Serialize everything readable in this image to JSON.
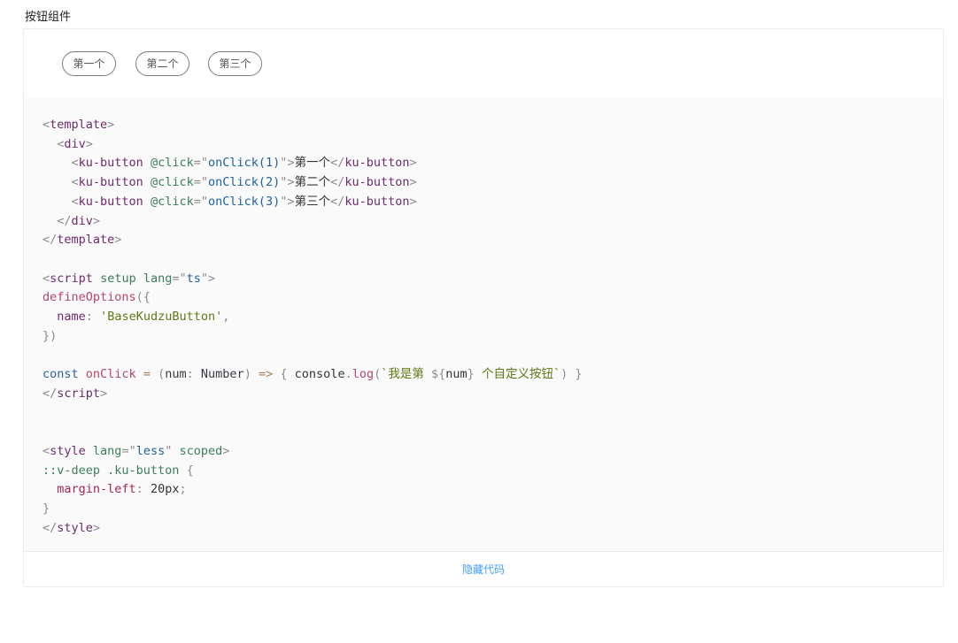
{
  "page": {
    "title": "按钮组件"
  },
  "preview": {
    "buttons": [
      {
        "label": "第一个"
      },
      {
        "label": "第二个"
      },
      {
        "label": "第三个"
      }
    ]
  },
  "code": {
    "lines": {
      "l1_tag": "template",
      "l2_tag": "div",
      "btn_tag": "ku-button",
      "btn_attr": "@click",
      "btn1_val": "onClick(1)",
      "btn2_val": "onClick(2)",
      "btn3_val": "onClick(3)",
      "btn1_text": "第一个",
      "btn2_text": "第二个",
      "btn3_text": "第三个",
      "script_tag": "script",
      "script_attr1": "setup",
      "script_attr2": "lang",
      "script_lang": "ts",
      "define_fn": "defineOptions",
      "name_key": "name",
      "name_val": "'BaseKudzuButton'",
      "const_kw": "const",
      "fn_name": "onClick",
      "param": "num",
      "param_type": "Number",
      "console_obj": "console",
      "console_fn": "log",
      "tpl_str_1": "`我是第 ",
      "tpl_var": "num",
      "tpl_str_2": " 个自定义按钮`",
      "style_tag": "style",
      "style_attr1": "lang",
      "style_lang": "less",
      "style_attr2": "scoped",
      "selector": "::v-deep .ku-button",
      "css_prop": "margin-left",
      "css_val": "20px"
    }
  },
  "footer": {
    "toggle_label": "隐藏代码"
  },
  "colors": {
    "accent": "#409eff",
    "code_bg": "#fafafa",
    "border": "#ebebeb"
  }
}
